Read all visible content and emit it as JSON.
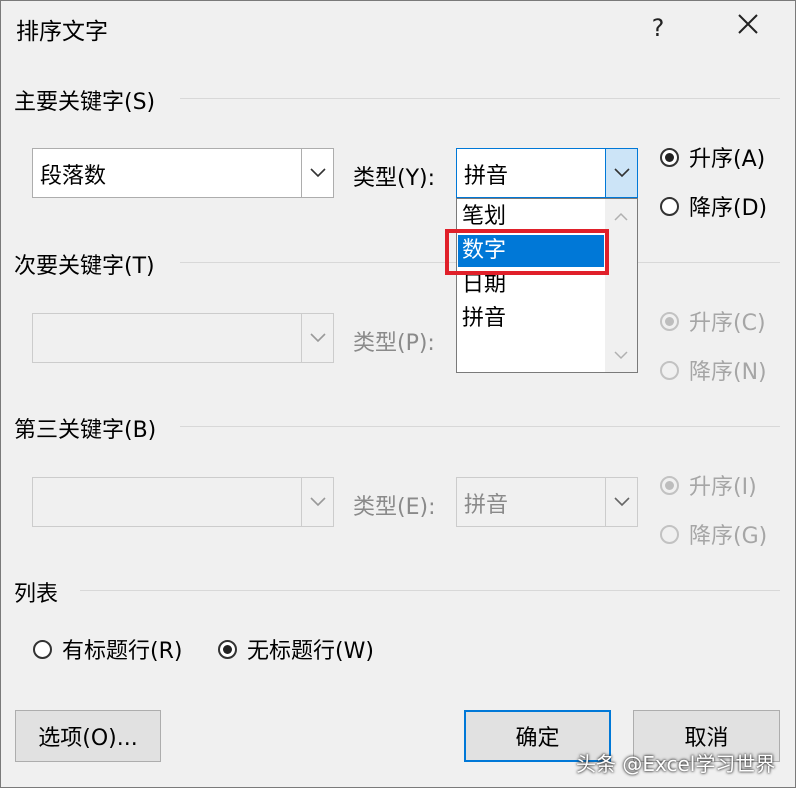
{
  "window": {
    "title": "排序文字",
    "help_label": "?",
    "close_label": "✕"
  },
  "primary_key": {
    "label": "主要关键字(S)",
    "field_value": "段落数",
    "type_label": "类型(Y):",
    "type_value": "拼音",
    "ascending_label": "升序(A)",
    "descending_label": "降序(D)",
    "selected": "ascending"
  },
  "type_dropdown": {
    "open": true,
    "options": [
      "笔划",
      "数字",
      "日期",
      "拼音"
    ],
    "highlighted_option": "数字",
    "highlight_color": "#e0202a",
    "selection_color": "#0078d7"
  },
  "secondary_key": {
    "label": "次要关键字(T)",
    "field_value": "",
    "type_label": "类型(P):",
    "ascending_label": "升序(C)",
    "descending_label": "降序(N)",
    "enabled": false
  },
  "tertiary_key": {
    "label": "第三关键字(B)",
    "field_value": "",
    "type_label": "类型(E):",
    "type_value": "拼音",
    "ascending_label": "升序(I)",
    "descending_label": "降序(G)",
    "enabled": false
  },
  "list": {
    "label": "列表",
    "has_header_label": "有标题行(R)",
    "no_header_label": "无标题行(W)",
    "selected": "no_header"
  },
  "buttons": {
    "options_label": "选项(O)...",
    "ok_label": "确定",
    "cancel_label": "取消"
  },
  "watermark": "头条 @Excel学习世界"
}
